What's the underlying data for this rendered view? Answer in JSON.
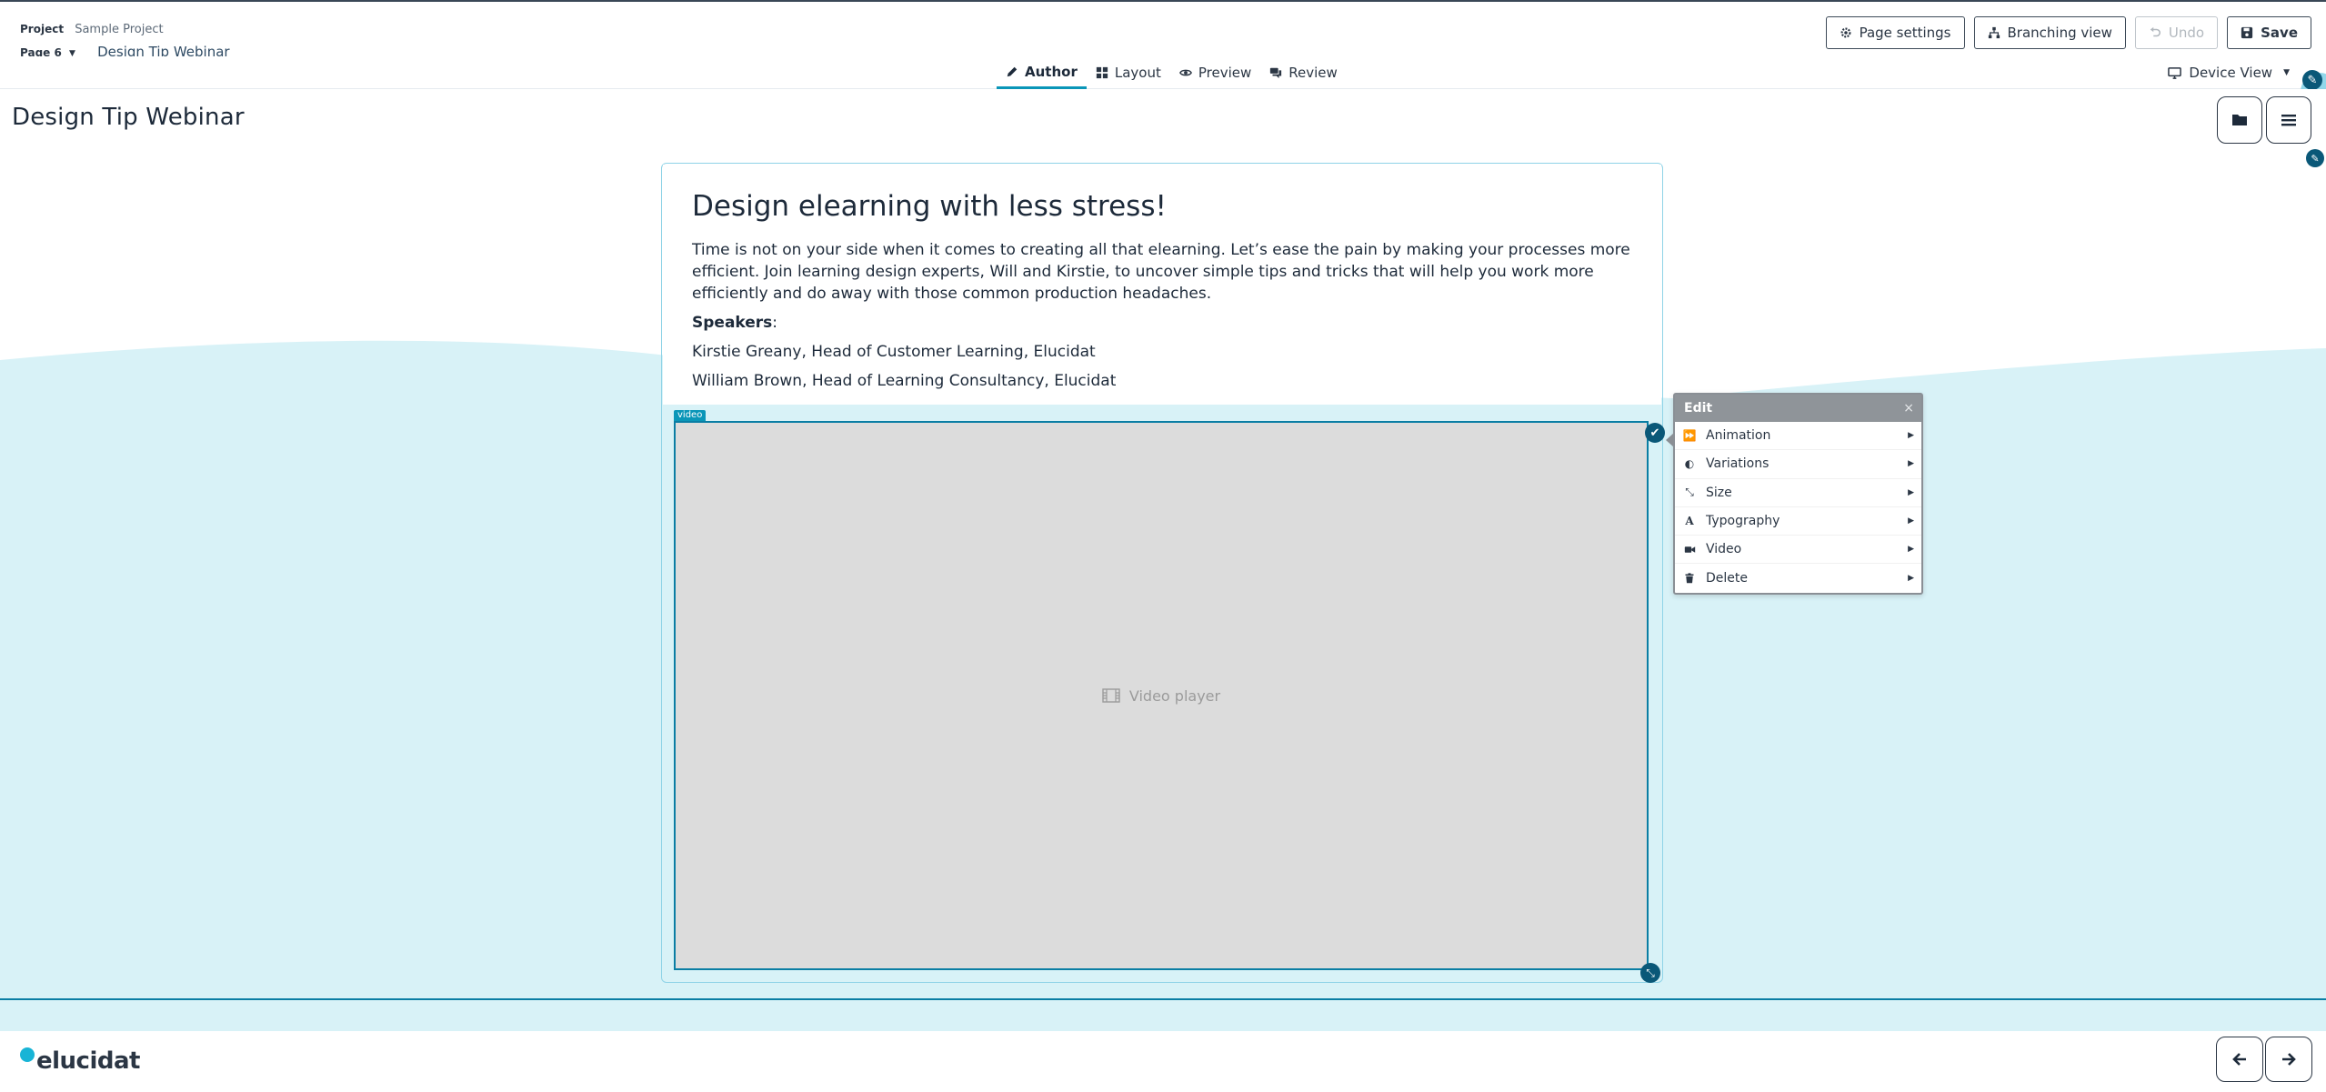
{
  "header": {
    "project_label": "Project",
    "project_name": "Sample Project",
    "page_label": "Page 6",
    "page_title": "Design Tip Webinar",
    "actions": {
      "page_settings": "Page settings",
      "branching_view": "Branching view",
      "undo": "Undo",
      "save": "Save"
    }
  },
  "modes": {
    "author": "Author",
    "layout": "Layout",
    "preview": "Preview",
    "review": "Review",
    "active": "Author"
  },
  "device_view": "Device View",
  "canvas": {
    "page_heading": "Design Tip Webinar",
    "content": {
      "title": "Design elearning with less stress!",
      "intro": "Time is not on your side when it comes to creating all that elearning. Let’s ease the pain by making your processes more efficient. Join learning design experts, Will and Kirstie, to uncover simple tips and tricks that will help you work more efficiently and do away with those common production headaches.",
      "speakers_label": "Speakers",
      "speakers_suffix": ":",
      "speaker_1": "Kirstie Greany, Head of Customer Learning, Elucidat",
      "speaker_2": "William Brown, Head of Learning Consultancy, Elucidat"
    },
    "video_tag": "video",
    "video_placeholder": "Video player"
  },
  "edit_menu": {
    "title": "Edit",
    "close": "×",
    "items": [
      {
        "label": "Animation",
        "icon": "fast-forward-icon"
      },
      {
        "label": "Variations",
        "icon": "contrast-icon"
      },
      {
        "label": "Size",
        "icon": "resize-icon"
      },
      {
        "label": "Typography",
        "icon": "font-icon"
      },
      {
        "label": "Video",
        "icon": "video-camera-icon"
      },
      {
        "label": "Delete",
        "icon": "trash-icon"
      }
    ]
  },
  "footer": {
    "logo_text": "elucidat"
  },
  "colors": {
    "accent": "#0a96b8",
    "dark_accent": "#0a5878",
    "canvas_wave": "#d8f2f7",
    "video_bg": "#dcdcdc"
  }
}
